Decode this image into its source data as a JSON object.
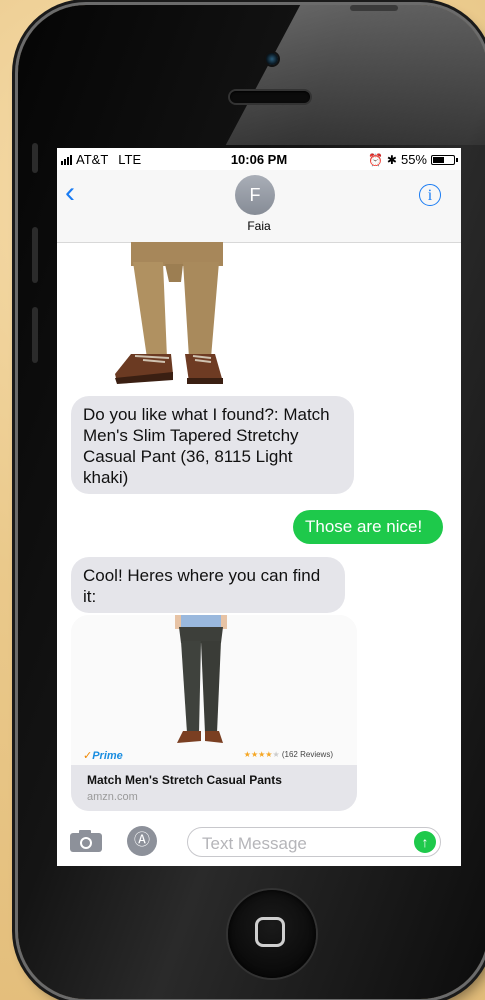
{
  "status_bar": {
    "carrier": "AT&T",
    "network": "LTE",
    "time": "10:06 PM",
    "battery": "55%",
    "battery_level": 0.55
  },
  "nav": {
    "back_icon": "chevron-left-icon",
    "avatar_initial": "F",
    "contact_name": "Faia",
    "info_icon": "info-icon"
  },
  "messages": [
    {
      "type": "received",
      "text": "Do you like what I found?: Match Men's Slim Tapered Stretchy Casual Pant (36, 8115 Light khaki)"
    },
    {
      "type": "sent",
      "text": "Those are nice!"
    },
    {
      "type": "received",
      "text": "Cool! Heres where you can find it:"
    }
  ],
  "link_preview": {
    "prime_label": "Prime",
    "rating": 4,
    "reviews": "(162 Reviews)",
    "title": "Match Men's Stretch Casual Pants",
    "url": "amzn.com"
  },
  "input": {
    "placeholder": "Text Message"
  },
  "colors": {
    "ios_blue": "#1a7cf3",
    "sent_green": "#1ec94b",
    "received_gray": "#e5e5ea",
    "background": "#e9c98a"
  }
}
